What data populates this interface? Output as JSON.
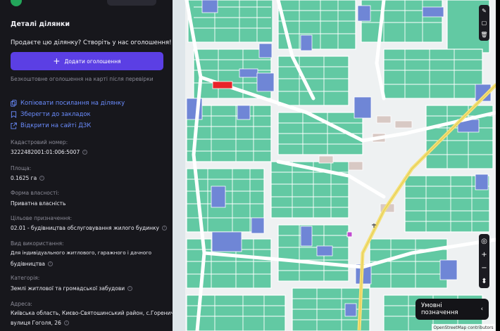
{
  "panel": {
    "title": "Деталі ділянки",
    "promo": "Продаєте цю ділянку? Створіть у нас оголошення!",
    "add_button": "Додати оголошення",
    "hint": "Безкоштовне оголошення на карті після перевірки",
    "links": {
      "copy": "Копіювати посилання на ділянку",
      "bookmark": "Зберегти до закладок",
      "dzk": "Відкрити на сайті ДЗК"
    }
  },
  "details": {
    "cadastral_label": "Кадастровий номер:",
    "cadastral_value": "3222482001:01:006:5007",
    "area_label": "Площа:",
    "area_value": "0.1625 га",
    "ownership_label": "Форма власності:",
    "ownership_value": "Приватна власність",
    "purpose_label": "Цільове призначення:",
    "purpose_value": "02.01 - будівництва обслуговування жилого будинку",
    "usage_label": "Вид використання:",
    "usage_value_line1": "Для індивідуального житлового, гаражного і дачного",
    "usage_value_line2": "будівництва",
    "category_label": "Категорія:",
    "category_value": "Землі житлової та громадської забудови",
    "address_label": "Адреса:",
    "address_value_line1": "Київська область, Києво-Святошинський район, с.Гореничі,",
    "address_value_line2": "вулиця Гоголя, 26"
  },
  "map": {
    "legend_button": "Умовні позначення",
    "attribution": "OpenStreetMap contributors",
    "colors": {
      "parcel": "#5ec7a0",
      "parcel_alt": "#7fd6b4",
      "parcel_blue": "#6a7fd0",
      "selected": "#e8232a",
      "road": "#ffffff",
      "main_road": "#f5e27a"
    }
  }
}
